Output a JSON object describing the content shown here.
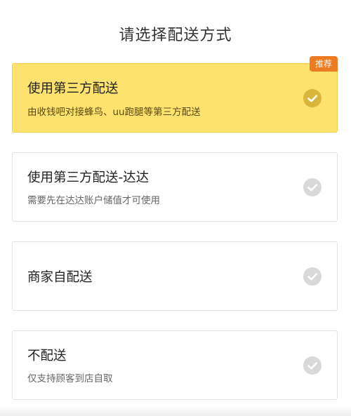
{
  "header": {
    "title": "请选择配送方式"
  },
  "options": [
    {
      "title": "使用第三方配送",
      "description": "由收钱吧对接蜂鸟、uu跑腿等第三方配送",
      "badge": "推荐",
      "selected": true
    },
    {
      "title": "使用第三方配送-达达",
      "description": "需要先在达达账户储值才可使用",
      "selected": false
    },
    {
      "title": "商家自配送",
      "selected": false
    },
    {
      "title": "不配送",
      "description": "仅支持顾客到店自取",
      "selected": false
    }
  ],
  "icons": {
    "check": "check-circle-icon"
  },
  "colors": {
    "selected_background": "#fde36e",
    "badge": "#ee7a22",
    "check_selected": "#d9b63a",
    "check_unselected": "#d9d9d9"
  }
}
